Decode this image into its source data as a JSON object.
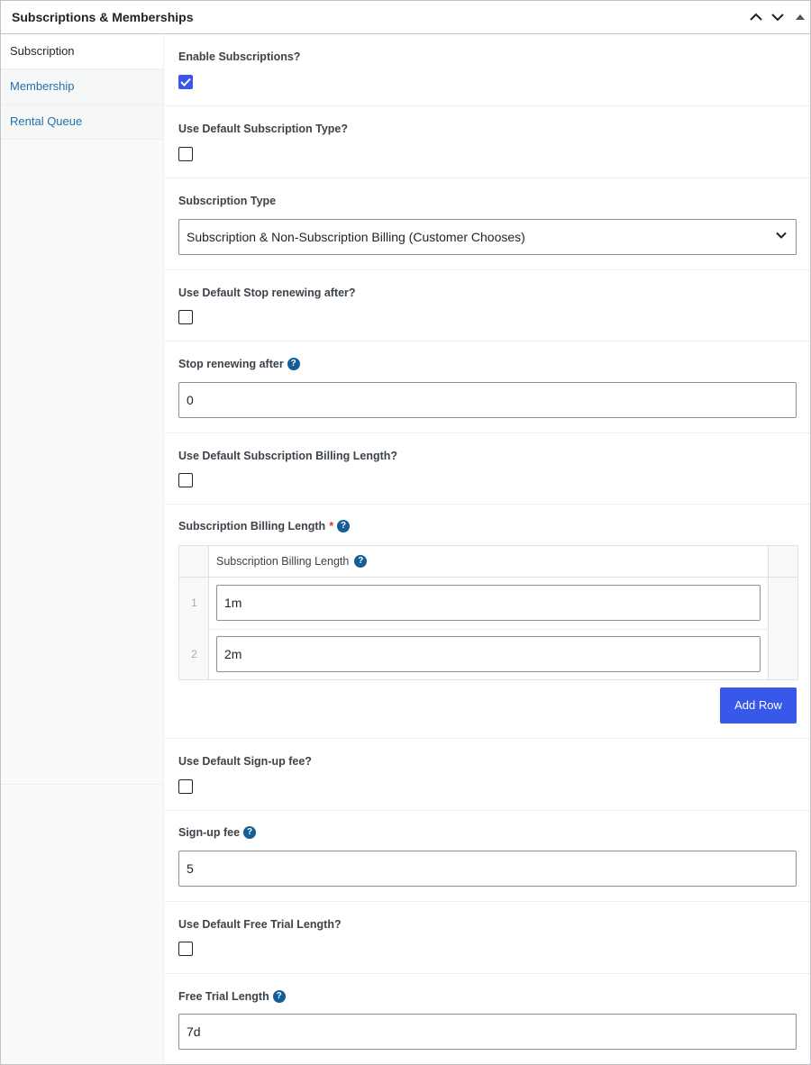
{
  "panel": {
    "title": "Subscriptions & Memberships"
  },
  "tabs": [
    {
      "label": "Subscription",
      "active": true
    },
    {
      "label": "Membership",
      "active": false
    },
    {
      "label": "Rental Queue",
      "active": false
    }
  ],
  "fields": {
    "enable_subscriptions": {
      "label": "Enable Subscriptions?",
      "checked": true
    },
    "use_default_subscription_type": {
      "label": "Use Default Subscription Type?",
      "checked": false
    },
    "subscription_type": {
      "label": "Subscription Type",
      "value": "Subscription & Non-Subscription Billing (Customer Chooses)"
    },
    "use_default_stop_renewing": {
      "label": "Use Default Stop renewing after?",
      "checked": false
    },
    "stop_renewing_after": {
      "label": "Stop renewing after",
      "value": "0"
    },
    "use_default_billing_length": {
      "label": "Use Default Subscription Billing Length?",
      "checked": false
    },
    "billing_length": {
      "label": "Subscription Billing Length",
      "required_mark": "*",
      "column_header": "Subscription Billing Length",
      "rows": [
        {
          "index": "1",
          "value": "1m"
        },
        {
          "index": "2",
          "value": "2m"
        }
      ],
      "add_row_label": "Add Row"
    },
    "use_default_signup_fee": {
      "label": "Use Default Sign-up fee?",
      "checked": false
    },
    "signup_fee": {
      "label": "Sign-up fee",
      "value": "5"
    },
    "use_default_free_trial": {
      "label": "Use Default Free Trial Length?",
      "checked": false
    },
    "free_trial_length": {
      "label": "Free Trial Length",
      "value": "7d"
    }
  },
  "help_glyph": "?",
  "colors": {
    "accent": "#3858e9",
    "link": "#2271b1",
    "help": "#135e96"
  }
}
